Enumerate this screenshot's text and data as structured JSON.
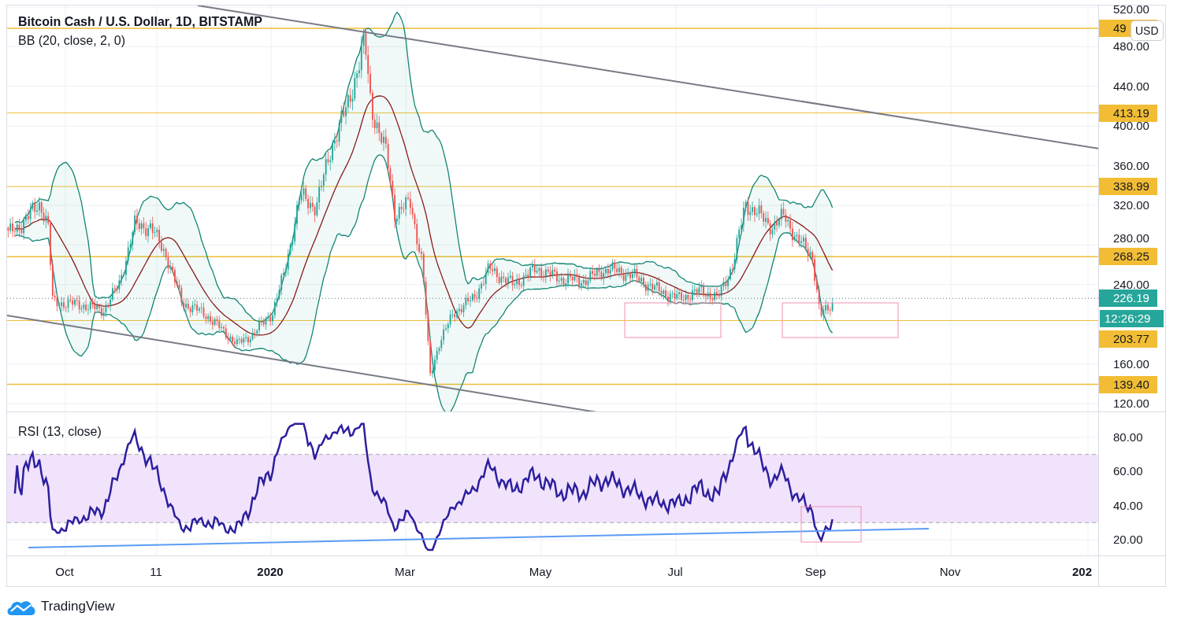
{
  "chart": {
    "title": "Bitcoin Cash / U.S. Dollar, 1D, BITSTAMP",
    "indicator": "BB (20, close, 2, 0)",
    "currency": "USD",
    "price_axis": {
      "ticks": [
        "520.00",
        "480.00",
        "440.00",
        "400.00",
        "360.00",
        "320.00",
        "280.00",
        "240.00",
        "160.00",
        "120.00"
      ],
      "levels": [
        {
          "label": "49"
        },
        {
          "label": "413.19"
        },
        {
          "label": "338.99"
        },
        {
          "label": "268.25"
        },
        {
          "label": "203.77"
        },
        {
          "label": "139.40"
        }
      ],
      "last_price": "226.19",
      "countdown": "12:26:29"
    },
    "rsi": {
      "title": "RSI (13, close)",
      "ticks": [
        "80.00",
        "60.00",
        "40.00",
        "20.00"
      ]
    },
    "time_axis": [
      {
        "label": "Oct",
        "kind": "month"
      },
      {
        "label": "11",
        "kind": "month"
      },
      {
        "label": "2020",
        "kind": "year"
      },
      {
        "label": "Mar",
        "kind": "month"
      },
      {
        "label": "May",
        "kind": "month"
      },
      {
        "label": "Jul",
        "kind": "month"
      },
      {
        "label": "Sep",
        "kind": "month"
      },
      {
        "label": "Nov",
        "kind": "month"
      },
      {
        "label": "202",
        "kind": "year"
      }
    ]
  },
  "footer": {
    "brand": "TradingView"
  }
}
